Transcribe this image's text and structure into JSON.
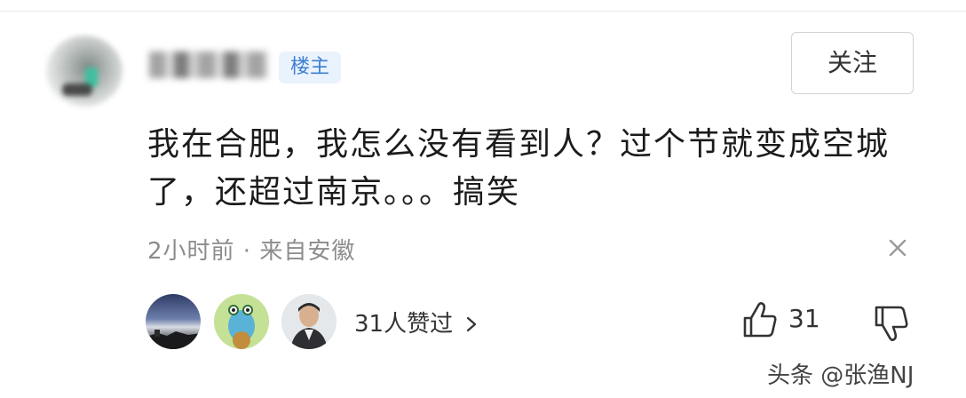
{
  "user": {
    "badge": "楼主"
  },
  "header": {
    "follow_label": "关注"
  },
  "comment": {
    "text": "我在合肥，我怎么没有看到人？过个节就变成空城了，还超过南京。。。搞笑",
    "meta": "2小时前 · 来自安徽"
  },
  "likes": {
    "summary": "31人赞过",
    "count": "31"
  },
  "watermark": {
    "text": "头条 @张渔NJ"
  },
  "icons": [
    "close-icon",
    "thumb-up-icon",
    "thumb-down-icon",
    "chevron-right-icon"
  ],
  "colors": {
    "badge_bg": "#eaf3fd",
    "badge_text": "#3d7fd1",
    "meta_text": "#8c8c8c"
  }
}
